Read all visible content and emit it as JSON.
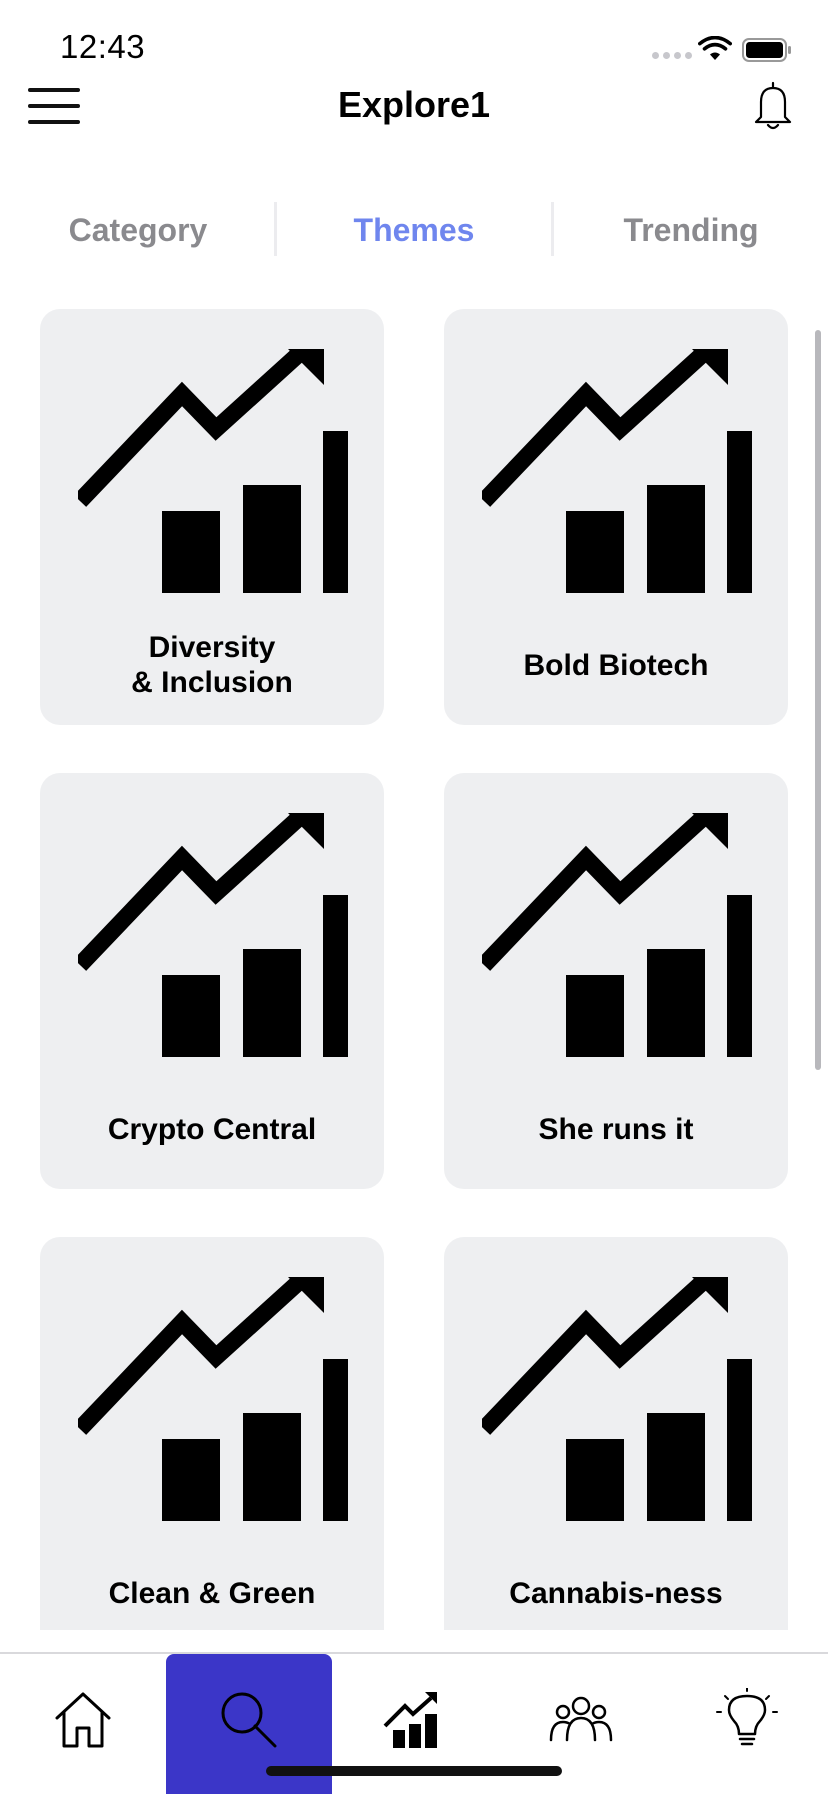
{
  "status_bar": {
    "time": "12:43"
  },
  "header": {
    "title": "Explore1"
  },
  "tabs": [
    {
      "label": "Category",
      "active": false
    },
    {
      "label": "Themes",
      "active": true
    },
    {
      "label": "Trending",
      "active": false
    }
  ],
  "themes": [
    {
      "label": "Diversity\n& Inclusion",
      "icon": "growth-chart-icon"
    },
    {
      "label": "Bold Biotech",
      "icon": "growth-chart-icon"
    },
    {
      "label": "Crypto Central",
      "icon": "growth-chart-icon"
    },
    {
      "label": "She runs it",
      "icon": "growth-chart-icon"
    },
    {
      "label": "Clean & Green",
      "icon": "growth-chart-icon"
    },
    {
      "label": "Cannabis-ness",
      "icon": "growth-chart-icon"
    }
  ],
  "bottom_nav": [
    {
      "icon": "home-icon",
      "active": false
    },
    {
      "icon": "search-icon",
      "active": true
    },
    {
      "icon": "chart-icon",
      "active": false
    },
    {
      "icon": "people-icon",
      "active": false
    },
    {
      "icon": "lightbulb-icon",
      "active": false
    }
  ],
  "colors": {
    "accent": "#6f86ee",
    "nav_active": "#3b36c8",
    "card_bg": "#eeeff1",
    "tab_inactive": "#8a8a8e"
  }
}
